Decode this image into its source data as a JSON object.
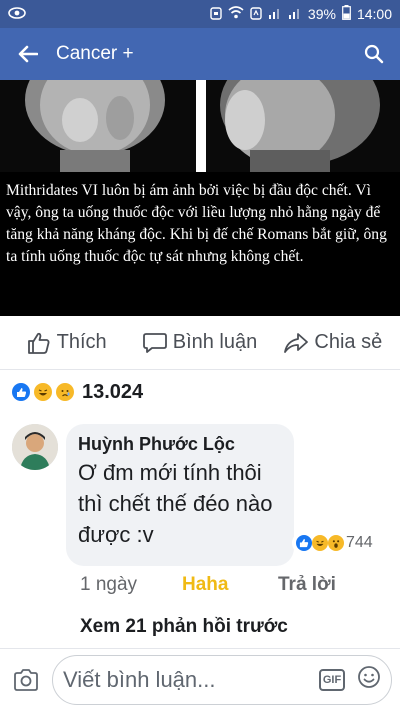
{
  "statusbar": {
    "battery": "39%",
    "time": "14:00"
  },
  "header": {
    "title": "Cancer +"
  },
  "post": {
    "image_text": "Mithridates VI luôn bị ám ảnh bởi việc bị đầu độc chết. Vì vậy, ông ta uống thuốc độc với liều lượng nhỏ hằng ngày để tăng khả năng kháng độc. Khi bị đế chế Romans bắt giữ, ông ta tính uống thuốc độc tự sát nhưng không chết."
  },
  "actions": {
    "like": "Thích",
    "comment": "Bình luận",
    "share": "Chia sẻ"
  },
  "reactions": {
    "count": "13.024"
  },
  "comment": {
    "author": "Huỳnh Phước Lộc",
    "text": "Ơ đm mới tính thôi thì chết thế đéo nào được :v",
    "reaction_count": "744",
    "time": "1 ngày",
    "haha": "Haha",
    "reply": "Trả lời"
  },
  "view_more": "Xem 21 phản hồi trước",
  "composer": {
    "placeholder": "Viết bình luận...",
    "gif": "GIF"
  }
}
